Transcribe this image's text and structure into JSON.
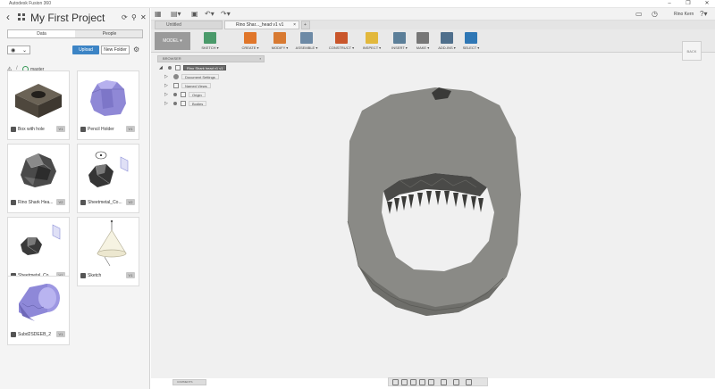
{
  "window": {
    "title": "Autodesk Fusion 360"
  },
  "data_panel": {
    "project_title": "My First Project",
    "tabs": [
      "Data",
      "People"
    ],
    "upload_label": "Upload",
    "new_folder_label": "New Folder",
    "breadcrumb": "master",
    "items": [
      {
        "name": "Box with hole",
        "version": "V1"
      },
      {
        "name": "Pencil Holder",
        "version": "V1"
      },
      {
        "name": "Rino Shark Hea...",
        "version": "V2"
      },
      {
        "name": "Sheetmetal_Co...",
        "version": "V2"
      },
      {
        "name": "Sheetmetal_Co...",
        "version": "V1"
      },
      {
        "name": "Sketch",
        "version": "V1"
      },
      {
        "name": "Subd2SDEEB_2",
        "version": "V1"
      }
    ]
  },
  "app_bar": {
    "user": "Rino Kern"
  },
  "doc_tabs": [
    {
      "label": "Untitled"
    },
    {
      "label": "Rino Shar..._head v1 v1"
    }
  ],
  "ribbon": {
    "workspace": "MODEL",
    "tools": [
      {
        "label": "SKETCH",
        "color": "#4a9a6a",
        "icon": "sketch-icon"
      },
      {
        "label": "CREATE",
        "color": "#e0762a",
        "icon": "create-box-icon"
      },
      {
        "label": "MODIFY",
        "color": "#d87a32",
        "icon": "modify-icon"
      },
      {
        "label": "ASSEMBLE",
        "color": "#6d8aa6",
        "icon": "assemble-icon"
      },
      {
        "label": "CONSTRUCT",
        "color": "#c9562b",
        "icon": "construct-plane-icon"
      },
      {
        "label": "INSPECT",
        "color": "#e2b83c",
        "icon": "inspect-icon"
      },
      {
        "label": "INSERT",
        "color": "#5c7f99",
        "icon": "insert-image-icon"
      },
      {
        "label": "MAKE",
        "color": "#777777",
        "icon": "make-icon"
      },
      {
        "label": "ADD-INS",
        "color": "#4f6f8c",
        "icon": "add-ins-icon"
      },
      {
        "label": "SELECT",
        "color": "#2f77b5",
        "icon": "select-icon"
      }
    ]
  },
  "browser": {
    "header": "BROWSER",
    "root": "Rino Shark head v1 v1",
    "items": [
      "Document Settings",
      "Named Views",
      "Origin",
      "Bodies"
    ]
  },
  "viewcube": {
    "face": "BACK"
  },
  "comments_label": "COMMENTS"
}
